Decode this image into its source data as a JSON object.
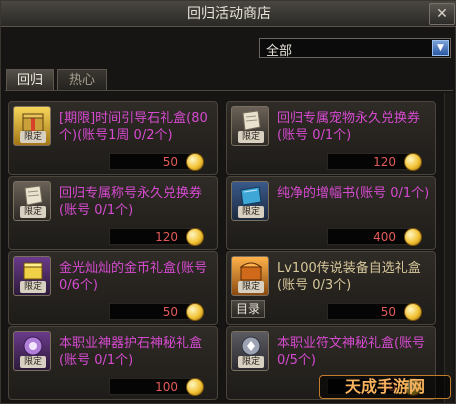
{
  "window": {
    "title": "回归活动商店",
    "close_label": "✕"
  },
  "filter": {
    "selected": "全部"
  },
  "tabs": [
    {
      "label": "回归"
    },
    {
      "label": "热心"
    }
  ],
  "items": [
    {
      "name": "[期限]时间引导石礼盒(80个)(账号1周 0/2个)",
      "price": "50",
      "limited": "限定",
      "icon": "gift-box-icon"
    },
    {
      "name": "回归专属宠物永久兑换券(账号 0/1个)",
      "price": "120",
      "limited": "限定",
      "icon": "scroll-icon"
    },
    {
      "name": "回归专属称号永久兑换券(账号 0/1个)",
      "price": "120",
      "limited": "限定",
      "icon": "scroll-icon"
    },
    {
      "name": "纯净的增幅书(账号 0/1个)",
      "price": "400",
      "limited": "限定",
      "icon": "book-icon"
    },
    {
      "name": "金光灿灿的金币礼盒(账号 0/6个)",
      "price": "50",
      "limited": "限定",
      "icon": "gold-box-icon"
    },
    {
      "name": "Lv100传说装备自选礼盒(账号 0/3个)",
      "price": "50",
      "limited": "限定",
      "icon": "chest-icon",
      "menu_label": "目录"
    },
    {
      "name": "本职业神器护石神秘礼盒(账号 0/1个)",
      "price": "100",
      "limited": "限定",
      "icon": "orb-icon"
    },
    {
      "name": "本职业符文神秘礼盒(账号 0/5个)",
      "price": "50",
      "limited": "限定",
      "icon": "rune-icon"
    }
  ],
  "watermark": "天成手游网"
}
